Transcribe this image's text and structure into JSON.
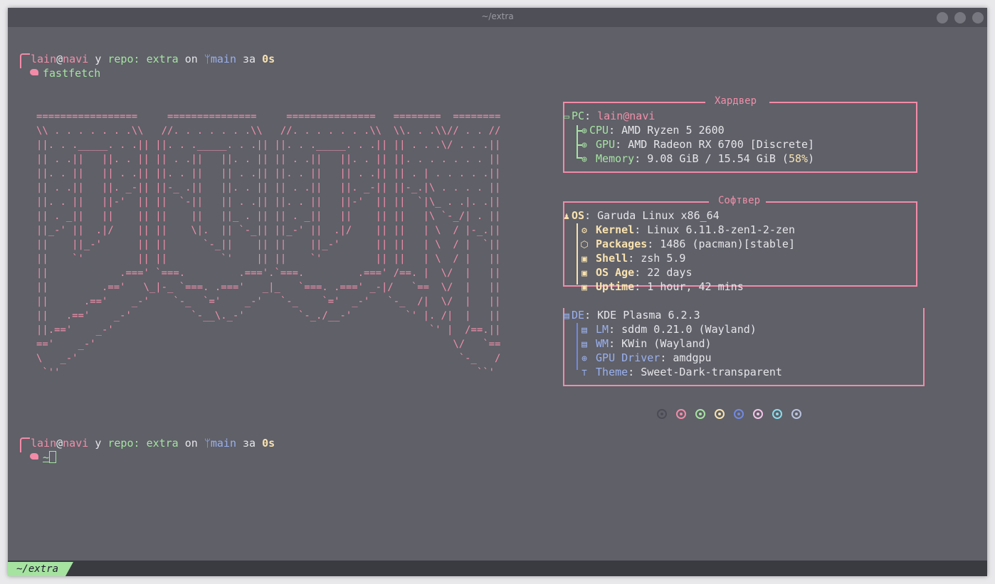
{
  "window": {
    "title": "~/extra"
  },
  "prompt1": {
    "user": "lain",
    "at": "@",
    "host": "navi",
    "in": "у",
    "repo_label": "repo:",
    "repo": "extra",
    "on": "on",
    "branch": "main",
    "za": "за",
    "duration": "0s",
    "command": "fastfetch"
  },
  "prompt2": {
    "user": "lain",
    "at": "@",
    "host": "navi",
    "in": "у",
    "repo_label": "repo:",
    "repo": "extra",
    "on": "on",
    "branch": "main",
    "za": "за",
    "duration": "0s",
    "dir": "~"
  },
  "ascii_logo": "=================     ===============     ===============   ========  ========\n\\\\ . . . . . . .\\\\   //. . . . . . .\\\\   //. . . . . . .\\\\  \\\\. . .\\\\// . . //\n||. . ._____. . .|| ||. . ._____. . .|| ||. . ._____. . .|| || . . .\\/ . . .||\n|| . .||   ||. . || || . .||   ||. . || || . .||   ||. . || ||. . . . . . . ||\n||. . ||   || . .|| ||. . ||   || . .|| ||. . ||   || . .|| || . | . . . . .||\n|| . .||   ||. _-|| ||-_ .||   ||. . || || . .||   ||. _-|| ||-_.|\\ . . . . ||\n||. . ||   ||-'  || ||  `-||   || . .|| ||. . ||   ||-'  || ||  `|\\_ . .|. .||\n|| . _||   ||    || ||    ||   ||_ . || || . _||   ||    || ||   |\\ `-_/| . ||\n||_-' ||  .|/    || ||    \\|.  || `-_|| ||_-' ||  .|/    || ||   | \\  / |-_.||\n||    ||_-'      || ||      `-_||    || ||    ||_-'      || ||   | \\  / |  `||\n||    `'         || ||         `'    || ||    `'         || ||   | \\  / |   ||\n||            .===' `===.         .==='.`===.         .===' /==. |  \\/  |   ||\n||         .=='   \\_|-_ `===. .==='   _|_   `===. .===' _-|/   `==  \\/  |   ||\n||      .=='    _-'    `-_  `='    _-'   `-_    `='  _-'   `-_  /|  \\/  |   ||\n||   .=='    _-'          `-__\\._-'         `-_./__-'         `' |. /|  |   ||\n||.=='    _-'                                                     `' |  /==.||\n=='    _-'                                                            \\/   `==\n\\   _-'                                                                `-_   /\n `''                                                                      ``'",
  "hardware": {
    "title": "Хардвер",
    "pc": {
      "label": "PC",
      "value": "lain@navi"
    },
    "items": [
      {
        "label": "CPU",
        "value": "AMD Ryzen 5 2600"
      },
      {
        "label": "GPU",
        "value": "AMD Radeon RX 6700 [Discrete]"
      },
      {
        "label": "Memory",
        "value": "9.08 GiB / 15.54 GiB (",
        "pct": "58%",
        "close": ")"
      }
    ]
  },
  "software": {
    "title": "Софтвер",
    "os": {
      "label": "OS",
      "value": "Garuda Linux x86_64"
    },
    "items": [
      {
        "label": "Kernel",
        "value": "Linux 6.11.8-zen1-2-zen"
      },
      {
        "label": "Packages",
        "value": "1486 (pacman)[stable]"
      },
      {
        "label": "Shell",
        "value": "zsh 5.9"
      },
      {
        "label": "OS Age",
        "value": "22 days"
      },
      {
        "label": "Uptime",
        "value": "1 hour, 42 mins"
      }
    ]
  },
  "desktop": {
    "de": {
      "label": "DE",
      "value": "KDE Plasma 6.2.3"
    },
    "items": [
      {
        "label": "LM",
        "value": "sddm 0.21.0 (Wayland)"
      },
      {
        "label": "WM",
        "value": "KWin (Wayland)"
      },
      {
        "label": "GPU Driver",
        "value": "amdgpu"
      },
      {
        "label": "Theme",
        "value": "Sweet-Dark-transparent"
      }
    ]
  },
  "palette": [
    "#4a4b55",
    "#f38ba8",
    "#a6e3a1",
    "#f9e2af",
    "#7289e0",
    "#f5c2e7",
    "#89dceb",
    "#bac2de"
  ],
  "colors": {
    "background": "#5f6068",
    "hardware": "#f38ba8",
    "software": "#f9e2af",
    "desktop": "#7289e0"
  },
  "statusbar": {
    "tab": "~/extra"
  }
}
